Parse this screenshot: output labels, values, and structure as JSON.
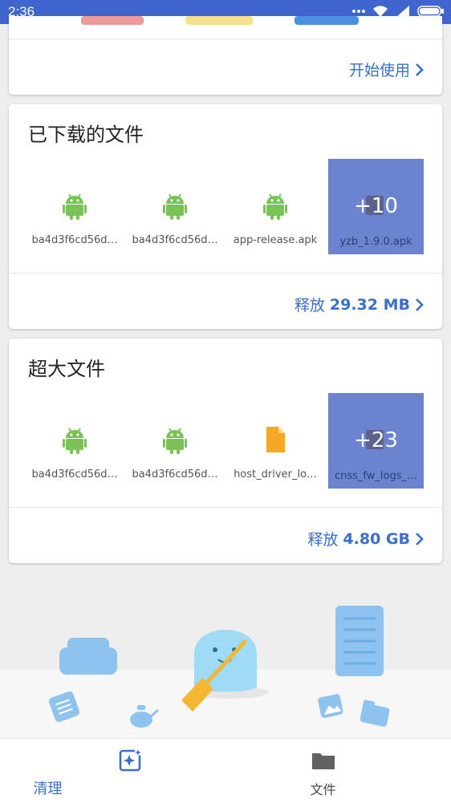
{
  "statusbar": {
    "time": "2:36"
  },
  "card_top": {
    "action_label": "开始使用"
  },
  "downloads": {
    "title": "已下载的文件",
    "files": [
      {
        "name": "ba4d3f6cd56d…",
        "icon": "android-icon"
      },
      {
        "name": "ba4d3f6cd56d…",
        "icon": "android-icon"
      },
      {
        "name": "app-release.apk",
        "icon": "android-icon"
      }
    ],
    "more": {
      "count": "+10",
      "name": "yzb_1.9.0.apk"
    },
    "action_prefix": "释放",
    "action_value": "29.32 MB"
  },
  "large_files": {
    "title": "超大文件",
    "files": [
      {
        "name": "ba4d3f6cd56d…",
        "icon": "android-icon"
      },
      {
        "name": "ba4d3f6cd56d…",
        "icon": "android-icon"
      },
      {
        "name": "host_driver_lo…",
        "icon": "document-icon"
      }
    ],
    "more": {
      "count": "+23",
      "name": "cnss_fw_logs_…"
    },
    "action_prefix": "释放",
    "action_value": "4.80 GB"
  },
  "nav": {
    "clean_label": "清理",
    "files_label": "文件"
  },
  "colors": {
    "accent": "#3a6fc8",
    "statusbar": "#3f66cf",
    "android": "#78c257",
    "document": "#f5a623",
    "tile": "#6c84cf"
  }
}
